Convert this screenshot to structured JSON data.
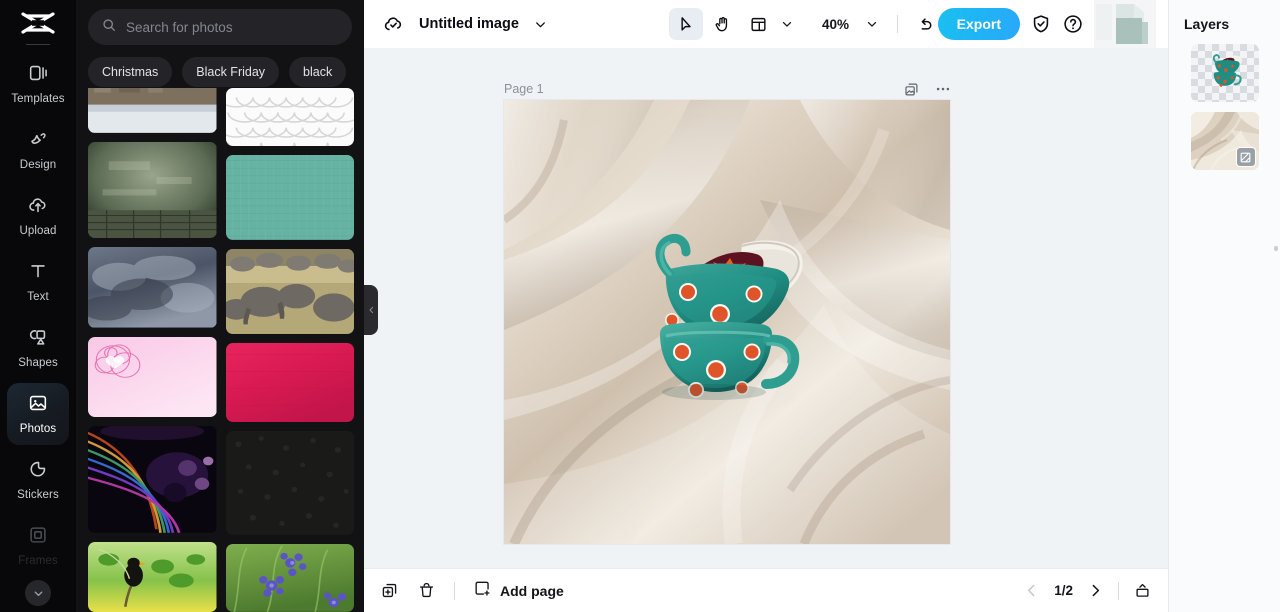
{
  "app": {
    "logo_icon": "capcut-logo-icon"
  },
  "rail": {
    "items": [
      {
        "label": "Templates",
        "icon": "templates-icon",
        "state": "normal"
      },
      {
        "label": "Design",
        "icon": "design-icon",
        "state": "normal"
      },
      {
        "label": "Upload",
        "icon": "upload-cloud-icon",
        "state": "normal"
      },
      {
        "label": "Text",
        "icon": "text-icon",
        "state": "normal"
      },
      {
        "label": "Shapes",
        "icon": "shapes-icon",
        "state": "normal"
      },
      {
        "label": "Photos",
        "icon": "photos-icon",
        "state": "active"
      },
      {
        "label": "Stickers",
        "icon": "stickers-icon",
        "state": "normal"
      },
      {
        "label": "Frames",
        "icon": "frames-icon",
        "state": "faded"
      }
    ],
    "more_icon": "chevron-down-icon"
  },
  "panel": {
    "search": {
      "placeholder": "Search for photos",
      "value": "",
      "icon": "search-icon"
    },
    "chips": [
      "Christmas",
      "Black Friday",
      "black"
    ],
    "collapse_icon": "chevron-left-icon",
    "photos": {
      "left_column": [
        {
          "name": "winter-town-photo",
          "alt": "Snowy town riverside"
        },
        {
          "name": "grunge-wall-photo",
          "alt": "Grunge green wall with wooden floor"
        },
        {
          "name": "storm-clouds-photo",
          "alt": "Dark storm clouds"
        },
        {
          "name": "pink-hearts-photo",
          "alt": "Pink background with heart swirls"
        },
        {
          "name": "fractal-lines-photo",
          "alt": "Colorful fractal light streaks"
        },
        {
          "name": "blackbird-photo",
          "alt": "Black bird on branch with green leaves"
        }
      ],
      "right_column": [
        {
          "name": "white-scales-photo",
          "alt": "White 3D scale pattern"
        },
        {
          "name": "teal-fabric-photo",
          "alt": "Teal woven fabric texture"
        },
        {
          "name": "elephants-photo",
          "alt": "Elephants bathing in river"
        },
        {
          "name": "crimson-paper-photo",
          "alt": "Crimson red paper texture"
        },
        {
          "name": "black-leather-photo",
          "alt": "Black leather texture"
        },
        {
          "name": "blue-flowers-photo",
          "alt": "Blue flowers in grass"
        }
      ]
    }
  },
  "topbar": {
    "cloud_icon": "cloud-saved-icon",
    "title": "Untitled image",
    "title_caret_icon": "chevron-down-icon",
    "tools": [
      {
        "name": "select-tool",
        "icon": "cursor-arrow-icon",
        "active": true
      },
      {
        "name": "hand-tool",
        "icon": "hand-icon",
        "active": false
      },
      {
        "name": "layout-tool",
        "icon": "layout-grid-icon",
        "active": false
      }
    ],
    "layout_caret_icon": "chevron-down-icon",
    "zoom": "40%",
    "zoom_caret_icon": "chevron-down-icon",
    "undo_icon": "undo-icon",
    "redo_icon": "redo-icon",
    "export_label": "Export",
    "shield_icon": "shield-check-icon",
    "help_icon": "help-circle-icon",
    "export_color": "#1fb4f5"
  },
  "canvas": {
    "page_label": "Page 1",
    "duplicate_icon": "duplicate-page-icon",
    "more_icon": "more-horizontal-icon",
    "artwork_alt": "Stacked teal polka-dot mugs on cream silk fabric"
  },
  "bottombar": {
    "duplicate_icon": "duplicate-page-icon",
    "delete_icon": "trash-icon",
    "add_page_icon": "add-page-icon",
    "add_page_label": "Add page",
    "prev_icon": "chevron-left-icon",
    "page_indicator": "1/2",
    "next_icon": "chevron-right-icon",
    "upload_icon": "export-upload-icon"
  },
  "layers": {
    "title": "Layers",
    "items": [
      {
        "name": "layer-mugs",
        "alt": "Mugs cutout on transparent background",
        "transparent": true,
        "badge": false
      },
      {
        "name": "layer-fabric",
        "alt": "Silk fabric background",
        "transparent": false,
        "badge": true,
        "badge_icon": "background-badge-icon"
      }
    ]
  }
}
